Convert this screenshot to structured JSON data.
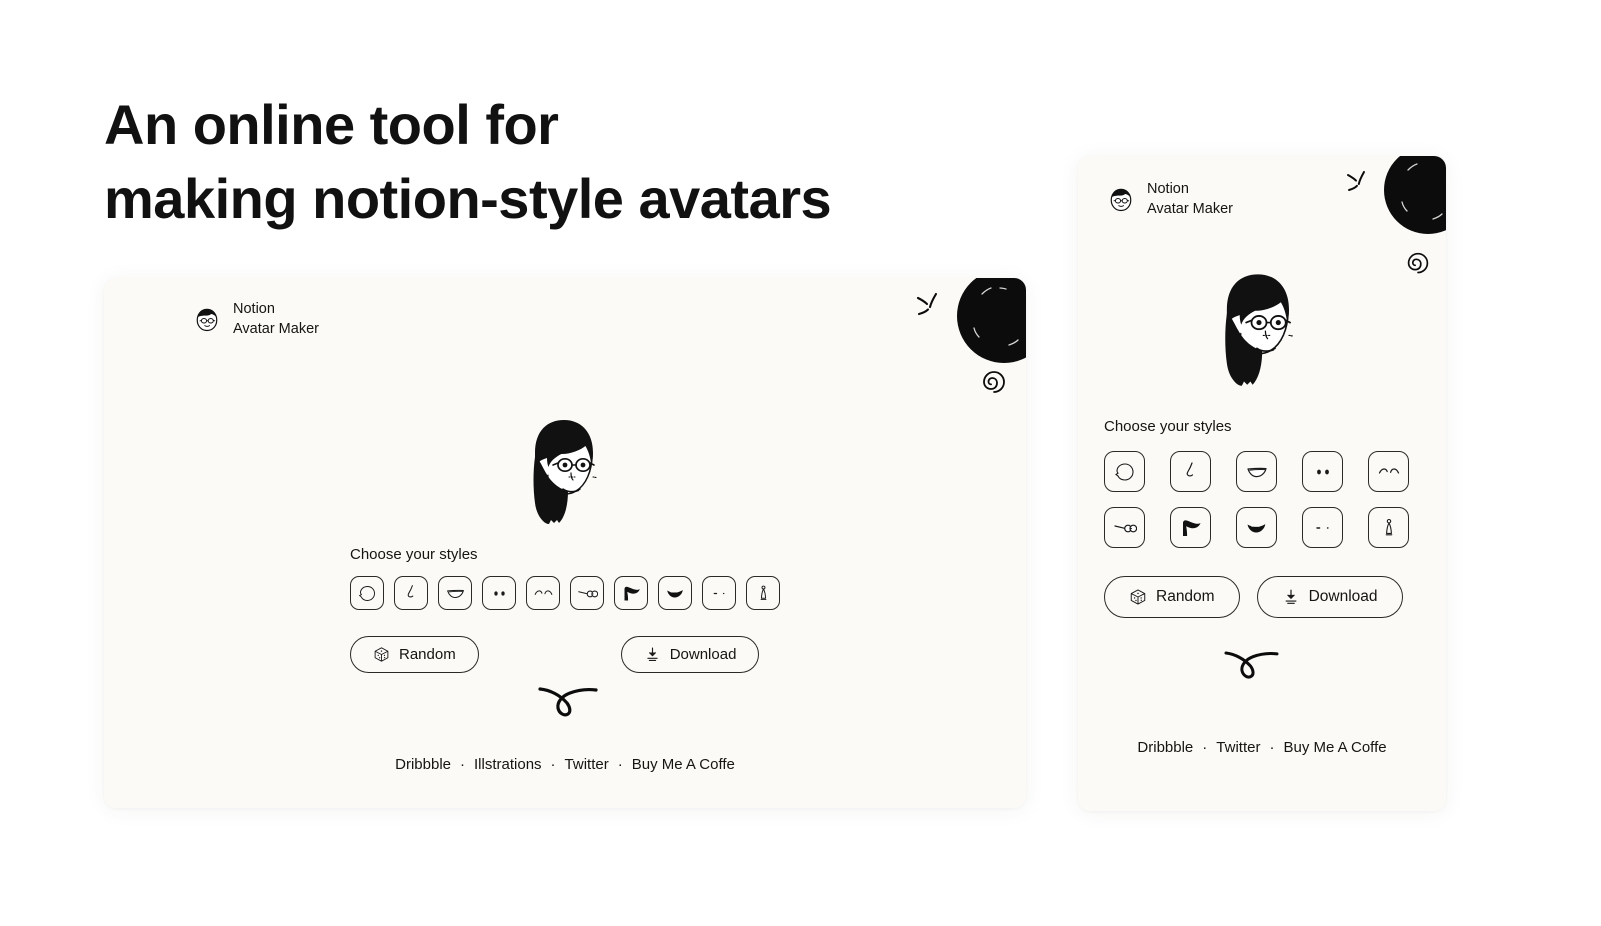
{
  "headline": "An online tool for\nmaking notion-style avatars",
  "brand": {
    "line1": "Notion",
    "line2": "Avatar Maker",
    "logo_icon": "avatar-face-icon"
  },
  "styles": {
    "title": "Choose your styles",
    "items": [
      {
        "id": "face",
        "label": "Face",
        "icon": "face-shape-icon"
      },
      {
        "id": "nose",
        "label": "Nose",
        "icon": "nose-icon"
      },
      {
        "id": "mouth",
        "label": "Mouth",
        "icon": "mouth-smile-icon"
      },
      {
        "id": "eyes",
        "label": "Eyes",
        "icon": "eyes-dots-icon"
      },
      {
        "id": "eyebrows",
        "label": "Eyebrows",
        "icon": "eyebrows-arc-icon"
      },
      {
        "id": "glasses",
        "label": "Glasses",
        "icon": "glasses-round-icon"
      },
      {
        "id": "hair",
        "label": "Hair",
        "icon": "hair-swoosh-icon"
      },
      {
        "id": "beard",
        "label": "Beard",
        "icon": "beard-icon"
      },
      {
        "id": "details",
        "label": "Details",
        "icon": "face-details-icon"
      },
      {
        "id": "accessory",
        "label": "Accessory",
        "icon": "earring-icon"
      }
    ]
  },
  "buttons": {
    "random": {
      "label": "Random",
      "icon": "dice-cube-icon"
    },
    "download": {
      "label": "Download",
      "icon": "download-arrow-icon"
    }
  },
  "footer": {
    "separator": "·",
    "desktop_links": [
      "Dribbble",
      "Illstrations",
      "Twitter",
      "Buy Me A Coffe"
    ],
    "mobile_links": [
      "Dribbble",
      "Twitter",
      "Buy Me A Coffe"
    ]
  },
  "decorations": {
    "blob": "black-blob-circle",
    "sparkle": "sparkle-lines",
    "spiral": "spiral-swirl",
    "swirl": "loop-swirl-stroke"
  },
  "avatar_preview": {
    "description": "woman-with-long-black-hair-and-round-glasses"
  },
  "colors": {
    "page_background": "#FFFFFF",
    "card_background": "#FBFAF7",
    "ink": "#16150F",
    "stroke": "#2B2A26"
  }
}
